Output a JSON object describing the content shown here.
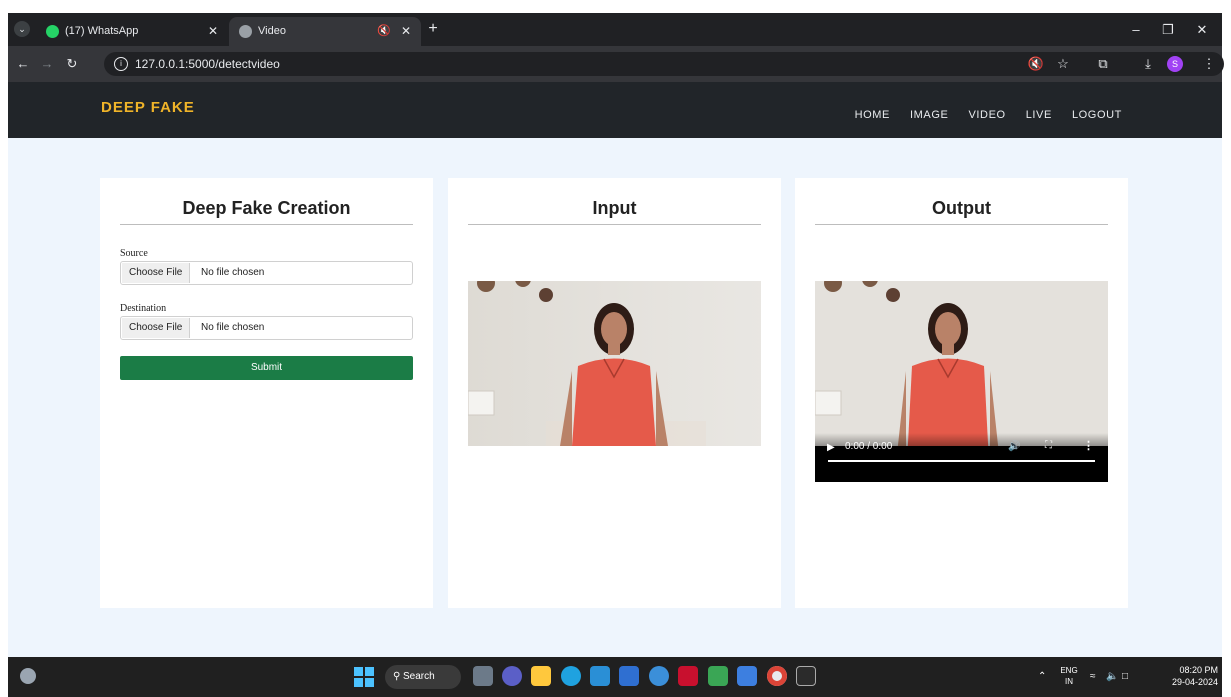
{
  "browser": {
    "tabs": [
      {
        "title": "(17) WhatsApp",
        "favicon": "whatsapp-icon",
        "active": false
      },
      {
        "title": "Video",
        "favicon": "globe-icon",
        "active": true
      }
    ],
    "url": "127.0.0.1:5000/detectvideo"
  },
  "site": {
    "brand": "DEEP FAKE",
    "nav": [
      "HOME",
      "IMAGE",
      "VIDEO",
      "LIVE",
      "LOGOUT"
    ]
  },
  "cards": {
    "creation": {
      "title": "Deep Fake Creation",
      "source_label": "Source",
      "destination_label": "Destination",
      "choose_file": "Choose File",
      "no_file": "No file chosen",
      "submit": "Submit"
    },
    "input": {
      "title": "Input"
    },
    "output": {
      "title": "Output",
      "time": "0:00 / 0:00"
    }
  },
  "taskbar": {
    "search": "Search",
    "lang": "ENG",
    "region": "IN",
    "time": "08:20 PM",
    "date": "29-04-2024"
  },
  "colors": {
    "brand": "#f0b429",
    "navbar": "#212529",
    "page_bg": "#eef5fd",
    "submit": "#1b7c46"
  }
}
